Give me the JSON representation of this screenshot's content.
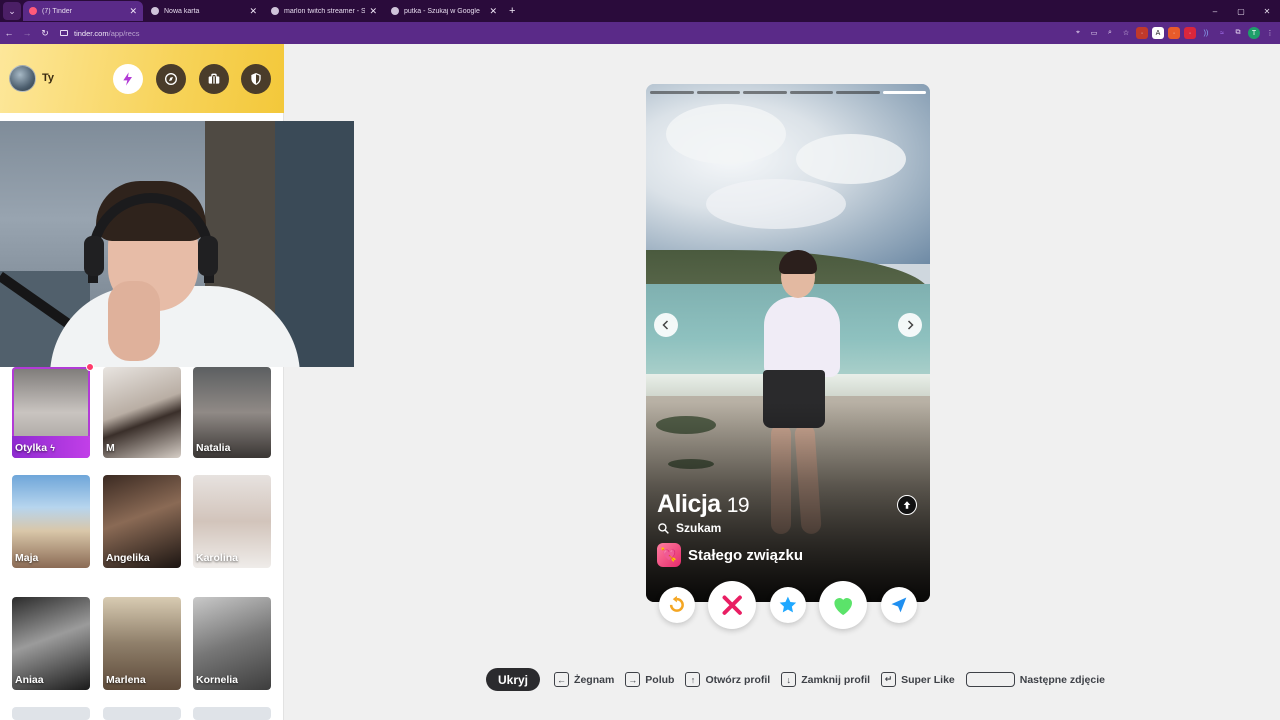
{
  "browser": {
    "tabs": [
      {
        "title": "(7) Tinder",
        "active": true
      },
      {
        "title": "Nowa karta",
        "active": false
      },
      {
        "title": "marlon twitch streamer - Szuka",
        "active": false
      },
      {
        "title": "putka - Szukaj w Google",
        "active": false
      }
    ],
    "new_tab": "+",
    "url_host": "tinder.com",
    "url_path": "/app/recs",
    "window_controls": [
      "–",
      "▢",
      "✕"
    ]
  },
  "sidebar": {
    "user_name": "Ty",
    "header_buttons": [
      "bolt-icon",
      "compass-icon",
      "briefcase-icon",
      "shield-icon"
    ],
    "matches": [
      {
        "name": "Otylka",
        "special": true
      },
      {
        "name": "M"
      },
      {
        "name": "Natalia"
      },
      {
        "name": "Maja"
      },
      {
        "name": "Angelika"
      },
      {
        "name": "Karolina"
      },
      {
        "name": "Aniaa"
      },
      {
        "name": "Marlena"
      },
      {
        "name": "Kornelia"
      }
    ]
  },
  "profile": {
    "name": "Alicja",
    "age": "19",
    "looking_label": "Szukam",
    "goal": "Stałego związku",
    "photo_count": 6,
    "current_photo": 6
  },
  "actions": [
    "rewind",
    "nope",
    "super-like",
    "like",
    "boost"
  ],
  "shortcuts": {
    "hide": "Ukryj",
    "items": [
      {
        "key": "←",
        "label": "Żegnam"
      },
      {
        "key": "→",
        "label": "Polub"
      },
      {
        "key": "↑",
        "label": "Otwórz profil"
      },
      {
        "key": "↓",
        "label": "Zamknij profil"
      },
      {
        "key": "↵",
        "label": "Super Like"
      },
      {
        "key": "",
        "label": "Następne zdjęcie"
      }
    ]
  },
  "colors": {
    "browser_frame": "#2a0b3b",
    "browser_toolbar": "#5a2a88",
    "tinder_gold": "#f7d35a",
    "nope": "#e91e63",
    "like": "#5be36a",
    "super_like": "#1fa8ff",
    "rewind": "#f4a623",
    "boost": "#1f8ff0"
  }
}
